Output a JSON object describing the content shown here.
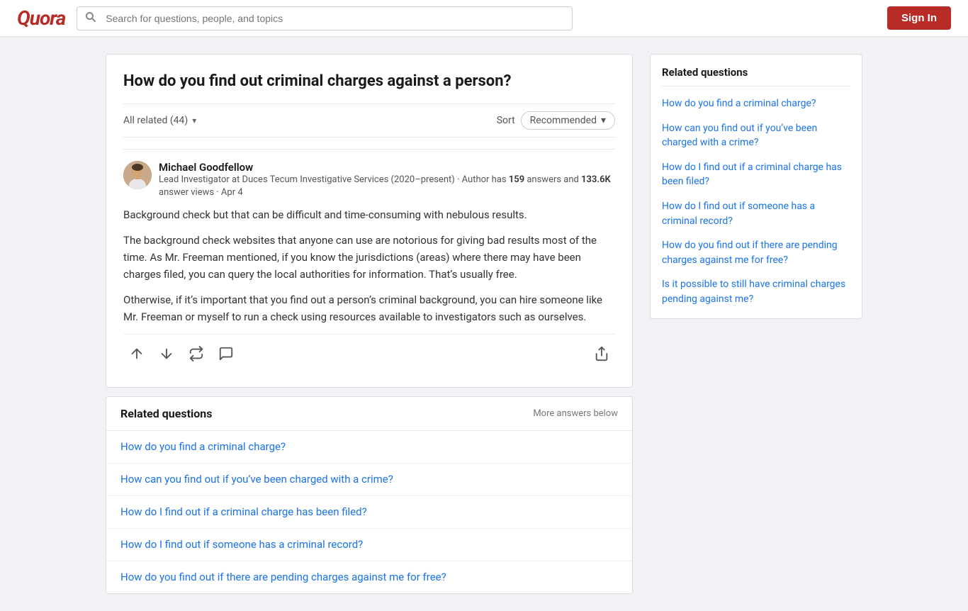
{
  "header": {
    "logo": "Quora",
    "search_placeholder": "Search for questions, people, and topics",
    "sign_in_label": "Sign In"
  },
  "question": {
    "title": "How do you find out criminal charges against a person?",
    "filter_label": "All related (44)",
    "sort_label": "Sort",
    "sort_value": "Recommended"
  },
  "answer": {
    "author_name": "Michael Goodfellow",
    "author_meta": "Lead Investigator at Duces Tecum Investigative Services (2020–present) · Author has ",
    "answer_count": "159",
    "author_meta2": " answers and ",
    "view_count": "133.6K",
    "author_meta3": " answer views · Apr 4",
    "paragraph1": "Background check but that can be difficult and time-consuming with nebulous results.",
    "paragraph2": "The background check websites that anyone can use are notorious for giving bad results most of the time. As Mr. Freeman mentioned, if you know the jurisdictions (areas) where there may have been charges filed, you can query the local authorities for information. That’s usually free.",
    "paragraph3": "Otherwise, if it’s important that you find out a person’s criminal background, you can hire someone like Mr. Freeman or myself to run a check using resources available to investigators such as ourselves."
  },
  "related_inline": {
    "title": "Related questions",
    "more_answers": "More answers below",
    "items": [
      "How do you find a criminal charge?",
      "How can you find out if you’ve been charged with a crime?",
      "How do I find out if a criminal charge has been filed?",
      "How do I find out if someone has a criminal record?",
      "How do you find out if there are pending charges against me for free?"
    ]
  },
  "sidebar": {
    "title": "Related questions",
    "items": [
      "How do you find a criminal charge?",
      "How can you find out if you’ve been charged with a crime?",
      "How do I find out if a criminal charge has been filed?",
      "How do I find out if someone has a criminal record?",
      "How do you find out if there are pending charges against me for free?",
      "Is it possible to still have criminal charges pending against me?"
    ]
  }
}
